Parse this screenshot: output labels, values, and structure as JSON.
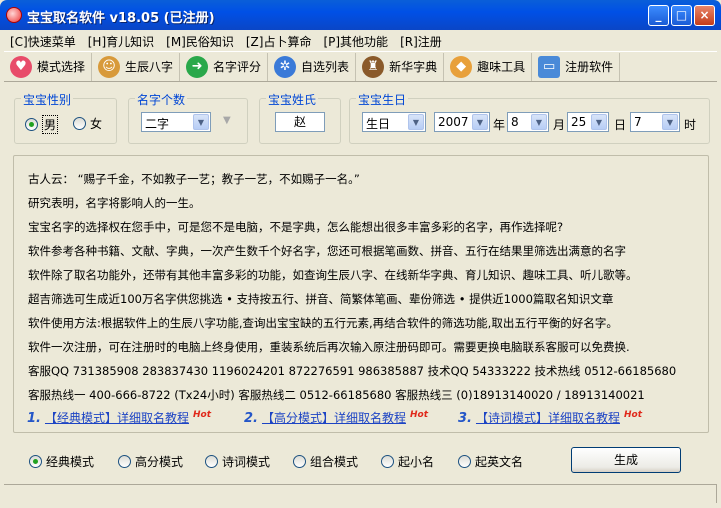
{
  "window": {
    "title": "宝宝取名软件  v18.05 (已注册)",
    "minimize": "_",
    "maximize": "□",
    "close": "×"
  },
  "menu": [
    "[C]快速菜单",
    "[H]育儿知识",
    "[M]民俗知识",
    "[Z]占卜算命",
    "[P]其他功能",
    "[R]注册"
  ],
  "toolbar": [
    {
      "label": "模式选择",
      "icon": "heart-icon",
      "color": "#e84c6a"
    },
    {
      "label": "生辰八字",
      "icon": "people-icon",
      "color": "#d89a3a"
    },
    {
      "label": "名字评分",
      "icon": "arrow-right-icon",
      "color": "#2aa84a"
    },
    {
      "label": "自选列表",
      "icon": "globe-gear-icon",
      "color": "#3a7ad8"
    },
    {
      "label": "新华字典",
      "icon": "scholar-icon",
      "color": "#8a5a2a"
    },
    {
      "label": "趣味工具",
      "icon": "windows-flag-icon",
      "color": "#e8a03a"
    },
    {
      "label": "注册软件",
      "icon": "monitor-icon",
      "color": "#4a8ad8"
    }
  ],
  "gender": {
    "title": "宝宝性别",
    "options": [
      "男",
      "女"
    ],
    "selected": "男"
  },
  "name_count": {
    "title": "名字个数",
    "value": "二字"
  },
  "surname": {
    "title": "宝宝姓氏",
    "value": "赵"
  },
  "birth": {
    "title": "宝宝生日",
    "calendar": "生日",
    "year": "2007",
    "year_unit": "年",
    "month": "8",
    "month_unit": "月",
    "day": "25",
    "day_unit": "日",
    "hour": "7",
    "hour_unit": "时"
  },
  "info": {
    "lines": [
      "古人云：  “赐子千金，不如教子一艺；教子一艺，不如赐子一名。”",
      "研究表明，名字将影响人的一生。",
      "宝宝名字的选择权在您手中，可是您不是电脑，不是字典，怎么能想出很多丰富多彩的名字，再作选择呢?",
      "软件参考各种书籍、文献、字典，一次产生数千个好名字，您还可根据笔画数、拼音、五行在结果里筛选出满意的名字",
      "软件除了取名功能外，还带有其他丰富多彩的功能，如查询生辰八字、在线新华字典、育儿知识、趣味工具、听儿歌等。",
      "超吉筛选可生成近100万名字供您挑选   •  支持按五行、拼音、简繁体笔画、辈份筛选  •  提供近1000篇取名知识文章",
      "软件使用方法:根据软件上的生辰八字功能,查询出宝宝缺的五行元素,再结合软件的筛选功能,取出五行平衡的好名字。",
      "软件一次注册，可在注册时的电脑上终身使用，重装系统后再次输入原注册码即可。需要更换电脑联系客服可以免费换.",
      "客服QQ 731385908   283837430   1196024201   872276591   986385887   技术QQ 54333222   技术热线 0512-66185680",
      "客服热线一 400-666-8722 (Tx24小时)   客服热线二 0512-66185680    客服热线三 (0)18913140020 / 18913140021"
    ]
  },
  "tutorials": [
    {
      "num": "1.",
      "label": "【经典模式】详细取名教程",
      "hot": "Hot"
    },
    {
      "num": "2.",
      "label": "【高分模式】详细取名教程",
      "hot": "Hot"
    },
    {
      "num": "3.",
      "label": "【诗词模式】详细取名教程",
      "hot": "Hot"
    }
  ],
  "modes": {
    "options": [
      "经典模式",
      "高分模式",
      "诗词模式",
      "组合模式",
      "起小名",
      "起英文名"
    ],
    "selected": "经典模式"
  },
  "generate": {
    "label": "生成"
  }
}
